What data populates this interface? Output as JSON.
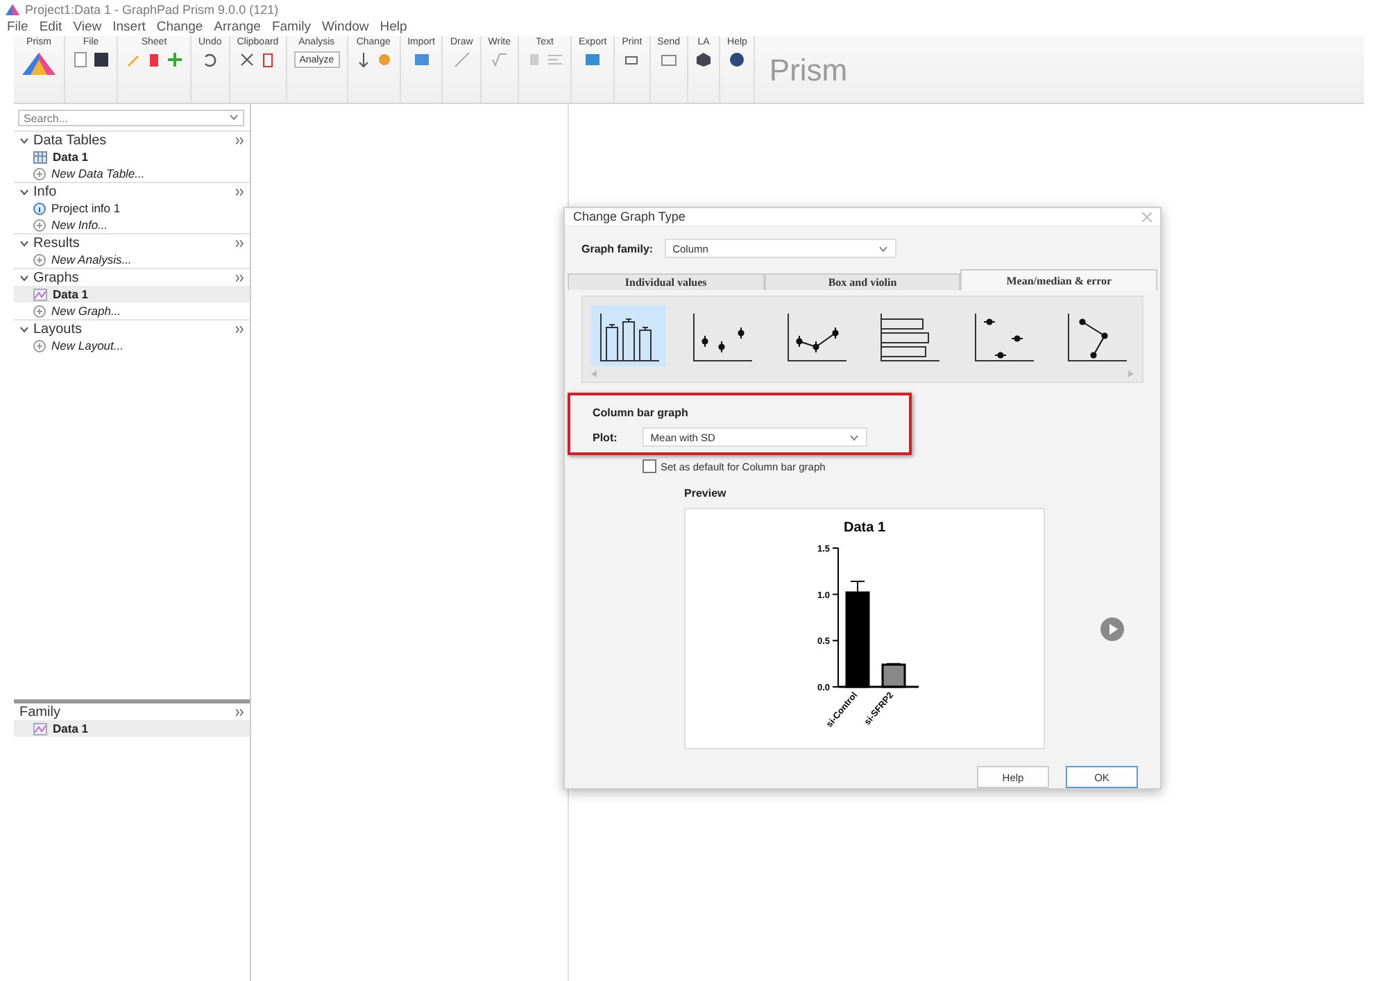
{
  "window": {
    "title": "Project1:Data 1 - GraphPad Prism 9.0.0 (121)"
  },
  "menu": [
    "File",
    "Edit",
    "View",
    "Insert",
    "Change",
    "Arrange",
    "Family",
    "Window",
    "Help"
  ],
  "ribbon": [
    {
      "label": "Prism"
    },
    {
      "label": "File"
    },
    {
      "label": "Sheet"
    },
    {
      "label": "Undo"
    },
    {
      "label": "Clipboard"
    },
    {
      "label": "Analysis",
      "button": "Analyze"
    },
    {
      "label": "Change"
    },
    {
      "label": "Import"
    },
    {
      "label": "Draw"
    },
    {
      "label": "Write"
    },
    {
      "label": "Text"
    },
    {
      "label": "Export"
    },
    {
      "label": "Print"
    },
    {
      "label": "Send"
    },
    {
      "label": "LA"
    },
    {
      "label": "Help"
    }
  ],
  "brand": "Prism",
  "sidebar": {
    "search": {
      "placeholder": "Search..."
    },
    "sections": [
      {
        "title": "Data Tables",
        "expanded": true,
        "items": [
          {
            "label": "Data 1",
            "kind": "table",
            "selected": false
          },
          {
            "label": "New Data Table...",
            "kind": "new",
            "selected": false
          }
        ]
      },
      {
        "title": "Info",
        "expanded": true,
        "items": [
          {
            "label": "Project info 1",
            "kind": "info",
            "selected": false
          },
          {
            "label": "New Info...",
            "kind": "new",
            "selected": false
          }
        ]
      },
      {
        "title": "Results",
        "expanded": true,
        "items": [
          {
            "label": "New Analysis...",
            "kind": "new",
            "selected": false
          }
        ]
      },
      {
        "title": "Graphs",
        "expanded": true,
        "items": [
          {
            "label": "Data 1",
            "kind": "graph",
            "selected": true
          },
          {
            "label": "New Graph...",
            "kind": "new",
            "selected": false
          }
        ]
      },
      {
        "title": "Layouts",
        "expanded": true,
        "items": [
          {
            "label": "New Layout...",
            "kind": "new",
            "selected": false
          }
        ]
      }
    ]
  },
  "family": {
    "title": "Family",
    "items": [
      {
        "label": "Data 1",
        "kind": "graph",
        "selected": true
      }
    ]
  },
  "dialog": {
    "title": "Change Graph Type",
    "family_label": "Graph family:",
    "family_value": "Column",
    "tabs": [
      {
        "label": "Individual values",
        "selected": false
      },
      {
        "label": "Box and violin",
        "selected": false
      },
      {
        "label": "Mean/median & error",
        "selected": true
      }
    ],
    "graph_types": [
      {
        "kind": "bars",
        "selected": true
      },
      {
        "kind": "dots",
        "selected": false
      },
      {
        "kind": "line",
        "selected": false
      },
      {
        "kind": "hbars",
        "selected": false
      },
      {
        "kind": "scatter",
        "selected": false
      },
      {
        "kind": "zigzag",
        "selected": false
      }
    ],
    "section_title": "Column bar graph",
    "plot_label": "Plot:",
    "plot_value": "Mean with SD",
    "highlighted": true,
    "default_checkbox": {
      "label": "Set as default for Column bar graph",
      "checked": false
    },
    "preview_label": "Preview",
    "chart_data": {
      "type": "bar",
      "title": "Data 1",
      "categories": [
        "si-Control",
        "si-SFRP2"
      ],
      "series": [
        {
          "values": [
            1.02,
            0.24
          ],
          "errors": [
            0.12,
            0.01
          ]
        }
      ],
      "ylim": [
        0,
        1.5
      ],
      "yticks": [
        {
          "value": 0,
          "label": "0.0"
        },
        {
          "value": 0.5,
          "label": "0.5"
        },
        {
          "value": 1,
          "label": "1.0"
        },
        {
          "value": 1.5,
          "label": "1.5"
        }
      ]
    },
    "buttons": [
      "Help",
      "OK"
    ]
  }
}
